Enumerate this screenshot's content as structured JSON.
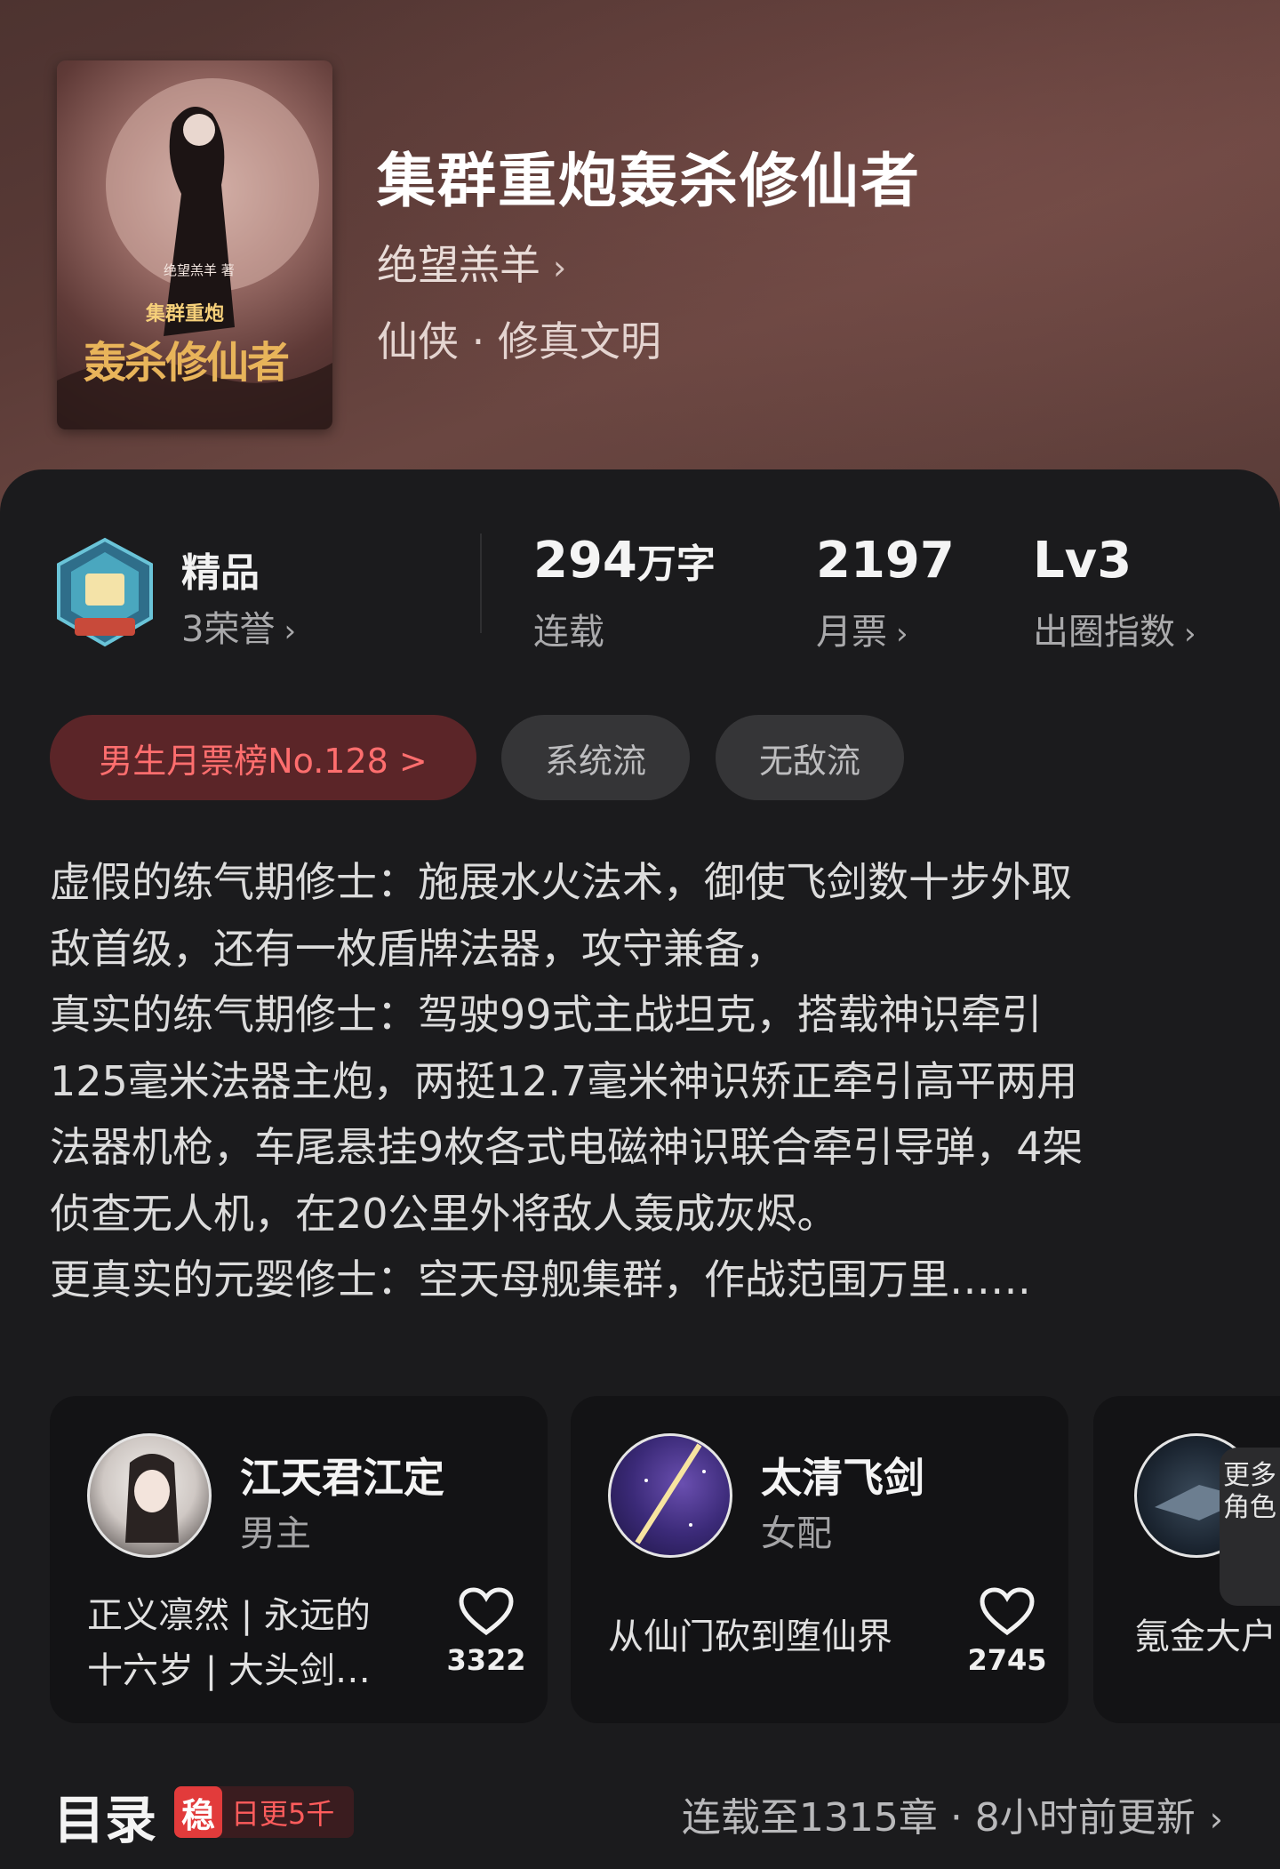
{
  "book": {
    "cover": {
      "author_text": "绝望羔羊 著",
      "subtitle_text": "集群重炮",
      "title_text": "轰杀修仙者"
    },
    "title": "集群重炮轰杀修仙者",
    "author": "绝望羔羊",
    "genre": "仙侠 · 修真文明"
  },
  "stats": {
    "badge": {
      "label": "精品",
      "sub": "3荣誉"
    },
    "words": {
      "value": "294",
      "unit": "万字",
      "label": "连载"
    },
    "monthly": {
      "value": "2197",
      "label": "月票"
    },
    "level": {
      "value": "Lv3",
      "label": "出圈指数"
    }
  },
  "tags": {
    "rank": "男生月票榜No.128 >",
    "items": [
      "系统流",
      "无敌流"
    ]
  },
  "description": [
    "虚假的练气期修士：施展水火法术，御使飞剑数十步外取",
    "敌首级，还有一枚盾牌法器，攻守兼备，",
    "真实的练气期修士：驾驶99式主战坦克，搭载神识牵引",
    "125毫米法器主炮，两挺12.7毫米神识矫正牵引高平两用",
    "法器机枪，车尾悬挂9枚各式电磁神识联合牵引导弹，4架",
    "侦查无人机，在20公里外将敌人轰成灰烬。",
    "更真实的元婴修士：空天母舰集群，作战范围万里……"
  ],
  "roles": [
    {
      "name": "江天君江定",
      "type": "男主",
      "desc_line1": "正义凛然 | 永远的",
      "desc_line2": "十六岁 | 大头剑…",
      "likes": "3322"
    },
    {
      "name": "太清飞剑",
      "type": "女配",
      "desc_line1": "从仙门砍到堕仙界",
      "likes": "2745"
    },
    {
      "desc_line1": "氪金大户"
    }
  ],
  "more_roles": "更多角色",
  "toc": {
    "title": "目录",
    "badge_stamp": "稳",
    "badge_text": "日更5千",
    "status": "连载至1315章 · 8小时前更新"
  }
}
